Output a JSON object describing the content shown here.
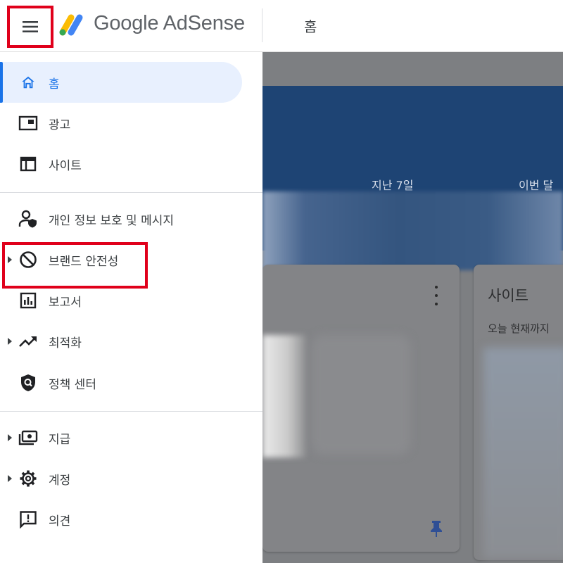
{
  "header": {
    "menu_icon": "hamburger-menu-icon",
    "logo_text": "Google AdSense",
    "page_title": "홈"
  },
  "sidebar": {
    "items": [
      {
        "label": "홈",
        "icon": "home-icon",
        "active": true,
        "expandable": false
      },
      {
        "label": "광고",
        "icon": "ads-icon",
        "active": false,
        "expandable": false
      },
      {
        "label": "사이트",
        "icon": "sites-icon",
        "active": false,
        "expandable": false
      },
      {
        "label": "개인 정보 보호 및 메시지",
        "icon": "privacy-messaging-icon",
        "active": false,
        "expandable": false
      },
      {
        "label": "브랜드 안전성",
        "icon": "block-icon",
        "active": false,
        "expandable": true
      },
      {
        "label": "보고서",
        "icon": "reports-icon",
        "active": false,
        "expandable": false
      },
      {
        "label": "최적화",
        "icon": "trending-up-icon",
        "active": false,
        "expandable": true
      },
      {
        "label": "정책 센터",
        "icon": "policy-shield-icon",
        "active": false,
        "expandable": false
      },
      {
        "label": "지급",
        "icon": "payments-icon",
        "active": false,
        "expandable": true
      },
      {
        "label": "계정",
        "icon": "gear-icon",
        "active": false,
        "expandable": true
      },
      {
        "label": "의견",
        "icon": "feedback-icon",
        "active": false,
        "expandable": false
      }
    ]
  },
  "main": {
    "earnings": {
      "last_7_days_label": "지난 7일",
      "this_month_label": "이번 달"
    },
    "sites_card": {
      "title": "사이트",
      "subtitle": "오늘 현재까지"
    }
  },
  "colors": {
    "highlight": "#e0001b",
    "accent": "#1a73e8",
    "active_bg": "#e8f0fe",
    "hero_bg": "#1e4474"
  }
}
